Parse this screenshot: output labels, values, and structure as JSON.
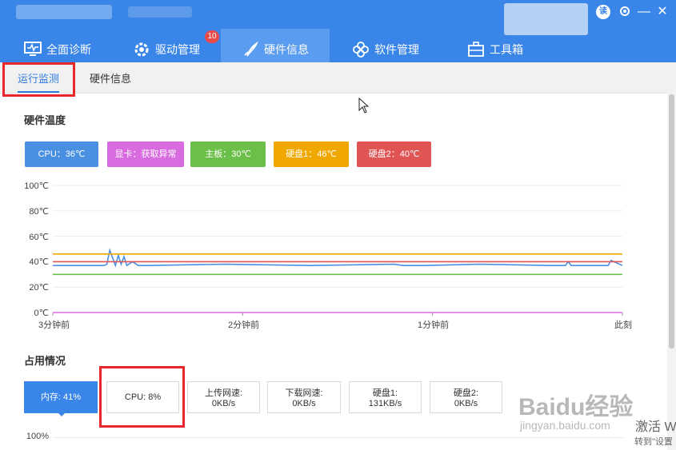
{
  "window": {
    "help_badge": "读",
    "settings_icon": "gear-icon",
    "minimize": "—",
    "close": "✕"
  },
  "tabs": [
    {
      "label": "全面诊断",
      "icon": "monitor-icon"
    },
    {
      "label": "驱动管理",
      "icon": "gear-icon",
      "badge": "10"
    },
    {
      "label": "硬件信息",
      "icon": "rocket-icon",
      "active": true
    },
    {
      "label": "软件管理",
      "icon": "flower-icon"
    },
    {
      "label": "工具箱",
      "icon": "toolbox-icon"
    }
  ],
  "subtabs": [
    {
      "label": "运行监测",
      "active": true
    },
    {
      "label": "硬件信息"
    }
  ],
  "hardware_temp": {
    "title": "硬件温度",
    "items": [
      {
        "label": "CPU：36℃",
        "color": "#4a90e2"
      },
      {
        "label": "显卡：获取异常",
        "color": "#d96be0"
      },
      {
        "label": "主板：30℃",
        "color": "#6cc04a"
      },
      {
        "label": "硬盘1：46℃",
        "color": "#f0a800"
      },
      {
        "label": "硬盘2：40℃",
        "color": "#e05454"
      }
    ]
  },
  "chart_data": {
    "type": "line",
    "yticks": [
      "100℃",
      "80℃",
      "60℃",
      "40℃",
      "20℃",
      "0℃"
    ],
    "xticks": [
      "3分钟前",
      "2分钟前",
      "1分钟前",
      "此刻"
    ],
    "ylim": [
      0,
      100
    ],
    "x": [
      0,
      18,
      19,
      20,
      21,
      22,
      23,
      24,
      25,
      26,
      28,
      30,
      33,
      60,
      90,
      120,
      123,
      130,
      150,
      175,
      180,
      181,
      182,
      190,
      195,
      196,
      200
    ],
    "series": [
      {
        "color": "#4a90e2",
        "values": [
          37,
          37,
          38,
          49,
          43,
          37,
          45,
          38,
          44,
          37,
          40,
          37,
          37,
          38,
          37,
          38,
          37,
          37,
          38,
          37,
          37,
          40,
          37,
          37,
          37,
          41,
          37
        ]
      },
      {
        "color": "#f0a800",
        "values": [
          46,
          46,
          46,
          46,
          46,
          46,
          46,
          46,
          46,
          46,
          46,
          46,
          46,
          46,
          46,
          46,
          46,
          46,
          46,
          46,
          46,
          46,
          46,
          46,
          46,
          46,
          46
        ]
      },
      {
        "color": "#e05454",
        "values": [
          40,
          40,
          40,
          40,
          40,
          40,
          40,
          40,
          40,
          40,
          40,
          40,
          40,
          40,
          40,
          40,
          40,
          40,
          40,
          40,
          40,
          40,
          40,
          40,
          40,
          40,
          40
        ]
      },
      {
        "color": "#6cc04a",
        "values": [
          30,
          30,
          30,
          30,
          30,
          30,
          30,
          30,
          30,
          30,
          30,
          30,
          30,
          30,
          30,
          30,
          30,
          30,
          30,
          30,
          30,
          30,
          30,
          30,
          30,
          30,
          30
        ]
      },
      {
        "color": "#d96be0",
        "values": [
          0,
          0,
          0,
          0,
          0,
          0,
          0,
          0,
          0,
          0,
          0,
          0,
          0,
          0,
          0,
          0,
          0,
          0,
          0,
          0,
          0,
          0,
          0,
          0,
          0,
          0,
          0
        ]
      }
    ]
  },
  "usage": {
    "title": "占用情况",
    "cards": [
      {
        "label": "内存: 41%",
        "value": ""
      },
      {
        "label": "CPU: 8%",
        "value": ""
      },
      {
        "label": "上传网速:",
        "value": "0KB/s"
      },
      {
        "label": "下载网速:",
        "value": "0KB/s"
      },
      {
        "label": "硬盘1:",
        "value": "131KB/s"
      },
      {
        "label": "硬盘2:",
        "value": "0KB/s"
      }
    ],
    "y_top": "100%"
  },
  "watermark": {
    "baidu": "Baidu经验",
    "url": "jingyan.baidu.com",
    "activate": "激活 W",
    "activate2": "转到\"设置"
  }
}
